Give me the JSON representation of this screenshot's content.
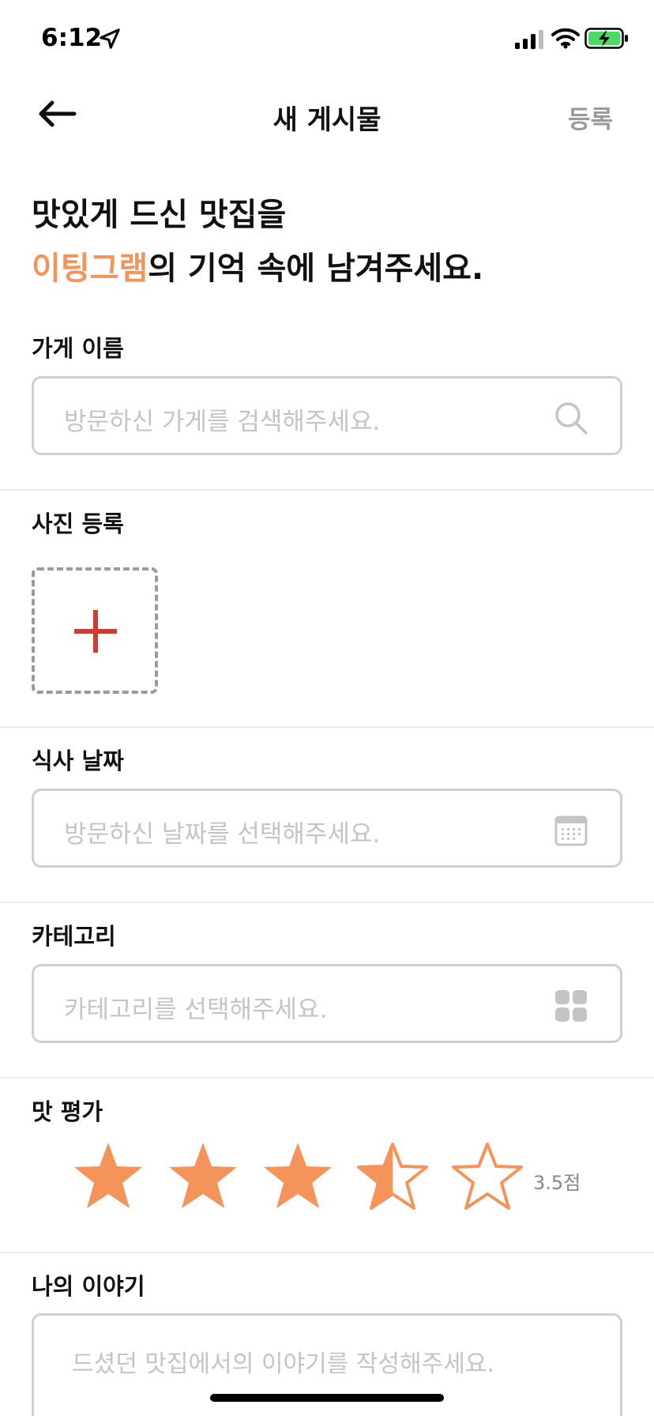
{
  "status_bar": {
    "time": "6:12"
  },
  "nav": {
    "title": "새 게시물",
    "submit_label": "등록"
  },
  "headline": {
    "line1": "맛있게 드신 맛집을",
    "brand": "이팅그램",
    "line2_rest": "의 기억 속에 남겨주세요."
  },
  "store": {
    "label": "가게 이름",
    "placeholder": "방문하신 가게를 검색해주세요."
  },
  "photo": {
    "label": "사진 등록"
  },
  "date": {
    "label": "식사 날짜",
    "placeholder": "방문하신 날짜를 선택해주세요."
  },
  "category": {
    "label": "카테고리",
    "placeholder": "카테고리를 선택해주세요."
  },
  "rating": {
    "label": "맛 평가",
    "value": 3.5,
    "max": 5,
    "text": "3.5점"
  },
  "story": {
    "label": "나의 이야기",
    "placeholder": "드셨던 맛집에서의 이야기를 작성해주세요."
  },
  "colors": {
    "accent": "#f5945a",
    "plus": "#d23a2f",
    "placeholder": "#c4c4c4",
    "border": "#cfcfcf"
  },
  "icons": [
    "back-arrow-icon",
    "search-icon",
    "calendar-icon",
    "grid-icon",
    "star-icon",
    "plus-icon"
  ]
}
